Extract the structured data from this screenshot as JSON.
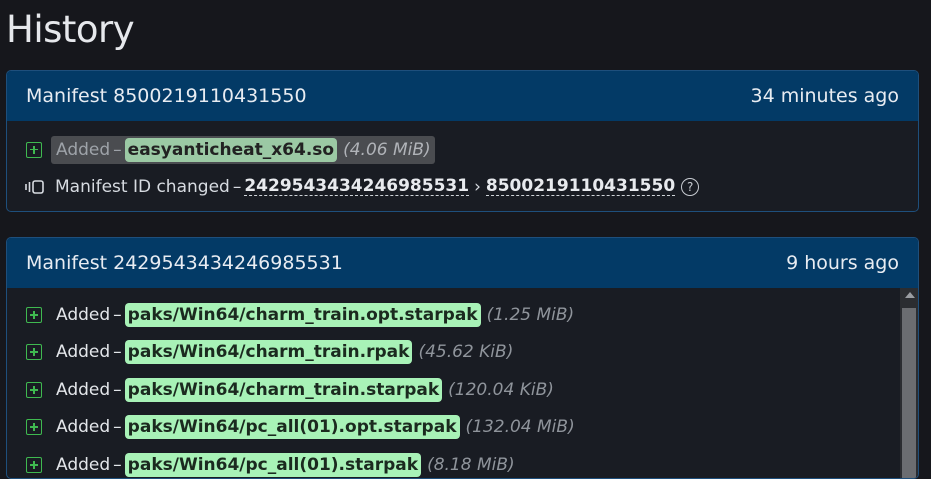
{
  "page": {
    "title": "History"
  },
  "manifests": [
    {
      "title": "Manifest 8500219110431550",
      "time": "34 minutes ago",
      "added": {
        "label": "Added",
        "dash": "–",
        "file": "easyanticheat_x64.so",
        "size": "(4.06 MiB)"
      },
      "id_change": {
        "label": "Manifest ID changed",
        "dash": "–",
        "from": "2429543434246985531",
        "arrow": "›",
        "to": "8500219110431550",
        "help": "?"
      }
    },
    {
      "title": "Manifest 2429543434246985531",
      "time": "9 hours ago",
      "changes": [
        {
          "label": "Added",
          "dash": "–",
          "file": "paks/Win64/charm_train.opt.starpak",
          "size": "(1.25 MiB)"
        },
        {
          "label": "Added",
          "dash": "–",
          "file": "paks/Win64/charm_train.rpak",
          "size": "(45.62 KiB)"
        },
        {
          "label": "Added",
          "dash": "–",
          "file": "paks/Win64/charm_train.starpak",
          "size": "(120.04 KiB)"
        },
        {
          "label": "Added",
          "dash": "–",
          "file": "paks/Win64/pc_all(01).opt.starpak",
          "size": "(132.04 MiB)"
        },
        {
          "label": "Added",
          "dash": "–",
          "file": "paks/Win64/pc_all(01).starpak",
          "size": "(8.18 MiB)"
        }
      ]
    }
  ],
  "colors": {
    "header_bg": "#033a66",
    "added_green": "#3fb950",
    "file_highlight": "#a8f2b7"
  }
}
